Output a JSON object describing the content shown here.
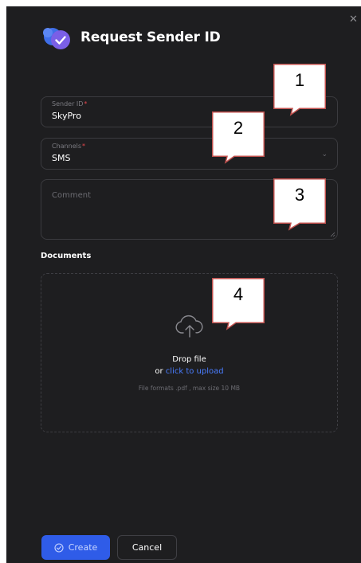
{
  "dialog": {
    "title": "Request Sender ID",
    "close_icon": "close-icon"
  },
  "fields": {
    "sender_id": {
      "label": "Sender ID",
      "required_mark": "*",
      "value": "SkyPro"
    },
    "channels": {
      "label": "Channels",
      "required_mark": "*",
      "value": "SMS",
      "icon": "chevron-down-icon"
    },
    "comment": {
      "placeholder": "Comment",
      "value": ""
    }
  },
  "documents": {
    "label": "Documents",
    "drop_title": "Drop file",
    "or_text": "or",
    "upload_link": "click to upload",
    "hint": "File formats .pdf , max size 10 MB",
    "icon": "cloud-upload-icon"
  },
  "actions": {
    "create_label": "Create",
    "create_icon": "check-circle-icon",
    "cancel_label": "Cancel"
  },
  "callouts": [
    "1",
    "2",
    "3",
    "4"
  ],
  "colors": {
    "background": "#1e1e20",
    "accent": "#2f5ce8",
    "link": "#4a7dff",
    "required": "#e8484d",
    "callout_border": "#c0504d"
  }
}
